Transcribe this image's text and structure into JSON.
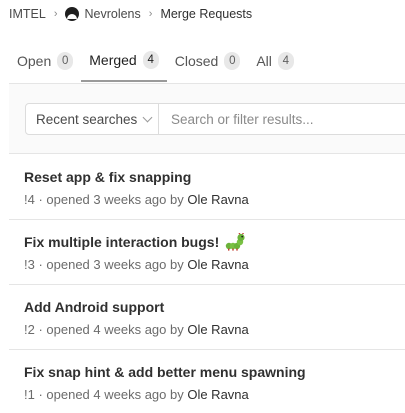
{
  "breadcrumb": {
    "group": "IMTEL",
    "project": "Nevrolens",
    "page": "Merge Requests",
    "separator": "›"
  },
  "tabs": [
    {
      "label": "Open",
      "count": "0",
      "active": false
    },
    {
      "label": "Merged",
      "count": "4",
      "active": true
    },
    {
      "label": "Closed",
      "count": "0",
      "active": false
    },
    {
      "label": "All",
      "count": "4",
      "active": false
    }
  ],
  "filter": {
    "recent_label": "Recent searches",
    "search_placeholder": "Search or filter results..."
  },
  "merge_requests": [
    {
      "title": "Reset app & fix snapping",
      "meta": "!4 · opened 3 weeks ago by ",
      "author": "Ole Ravna",
      "emoji": ""
    },
    {
      "title": "Fix multiple interaction bugs!",
      "meta": "!3 · opened 3 weeks ago by ",
      "author": "Ole Ravna",
      "emoji": "caterpillar"
    },
    {
      "title": "Add Android support",
      "meta": "!2 · opened 4 weeks ago by ",
      "author": "Ole Ravna",
      "emoji": ""
    },
    {
      "title": "Fix snap hint & add better menu spawning",
      "meta": "!1 · opened 4 weeks ago by ",
      "author": "Ole Ravna",
      "emoji": ""
    }
  ]
}
